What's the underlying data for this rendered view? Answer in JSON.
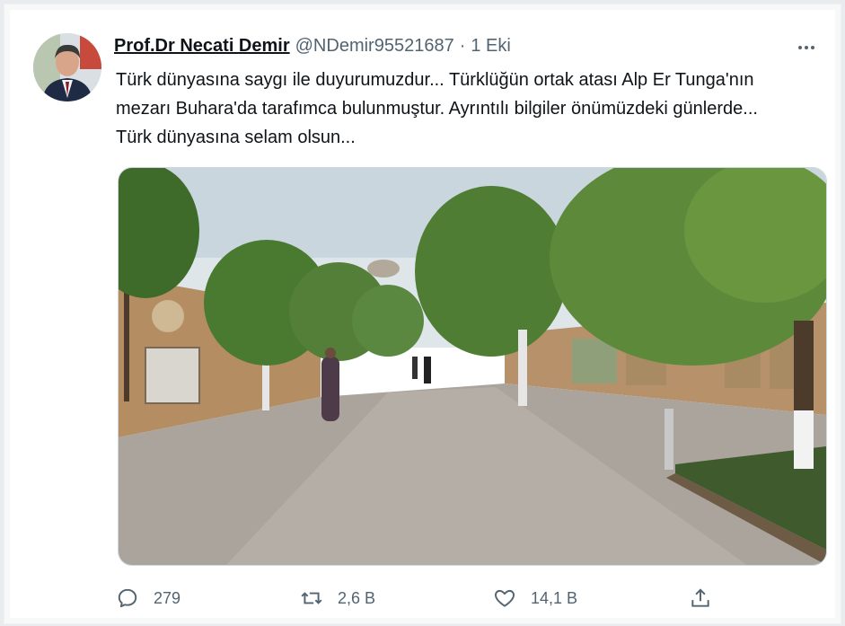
{
  "tweet": {
    "display_name": "Prof.Dr Necati Demir",
    "handle": "@NDemir95521687",
    "separator": "·",
    "timestamp": "1 Eki",
    "text": "Türk dünyasına saygı ile duyurumuzdur... Türklüğün ortak atası Alp Er Tunga'nın mezarı Buhara'da tarafımca bulunmuştur.  Ayrıntılı bilgiler önümüzdeki günlerde... Türk dünyasına selam olsun..."
  },
  "actions": {
    "replies": "279",
    "retweets": "2,6 B",
    "likes": "14,1 B"
  },
  "icons": {
    "more": "more-dots-icon",
    "reply": "reply-icon",
    "retweet": "retweet-icon",
    "like": "heart-icon",
    "share": "share-icon"
  },
  "colors": {
    "text": "#0f1419",
    "secondary": "#536471",
    "background": "#ffffff"
  }
}
